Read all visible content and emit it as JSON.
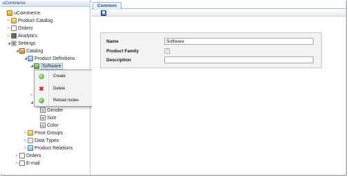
{
  "tree": {
    "header": "uCommerce",
    "nodes": [
      {
        "label": "uCommerce",
        "icon": "home-icon"
      },
      {
        "label": "Product Catalog",
        "icon": "folder-icon"
      },
      {
        "label": "Orders",
        "icon": "orders-icon"
      },
      {
        "label": "Analytics",
        "icon": "chart-icon"
      },
      {
        "label": "Settings",
        "icon": "gear-icon"
      },
      {
        "label": "Catalog",
        "icon": "catalog-icon"
      },
      {
        "label": "Product Definitions",
        "icon": "definitions-icon"
      },
      {
        "label": "Software",
        "icon": "software-icon"
      },
      {
        "label": "Gender",
        "icon": "field-icon"
      },
      {
        "label": "Size",
        "icon": "field-icon"
      },
      {
        "label": "Color",
        "icon": "field-icon"
      },
      {
        "label": "Price Groups",
        "icon": "price-groups-icon"
      },
      {
        "label": "Data Types",
        "icon": "data-types-icon"
      },
      {
        "label": "Product Relations",
        "icon": "relations-icon"
      },
      {
        "label": "Orders",
        "icon": "orders-icon"
      },
      {
        "label": "E-mail",
        "icon": "email-icon"
      }
    ]
  },
  "context_menu": {
    "items": [
      {
        "label": "Create",
        "icon": "create-icon"
      },
      {
        "label": "Delete",
        "icon": "delete-icon"
      },
      {
        "label": "Reload nodes",
        "icon": "reload-icon"
      }
    ]
  },
  "tabs": [
    {
      "label": "Common"
    }
  ],
  "toolbar": {
    "save_icon": "save-icon"
  },
  "form": {
    "name_label": "Name",
    "name_value": "Software",
    "family_label": "Product Family",
    "family_checked": true,
    "description_label": "Description",
    "description_value": ""
  }
}
